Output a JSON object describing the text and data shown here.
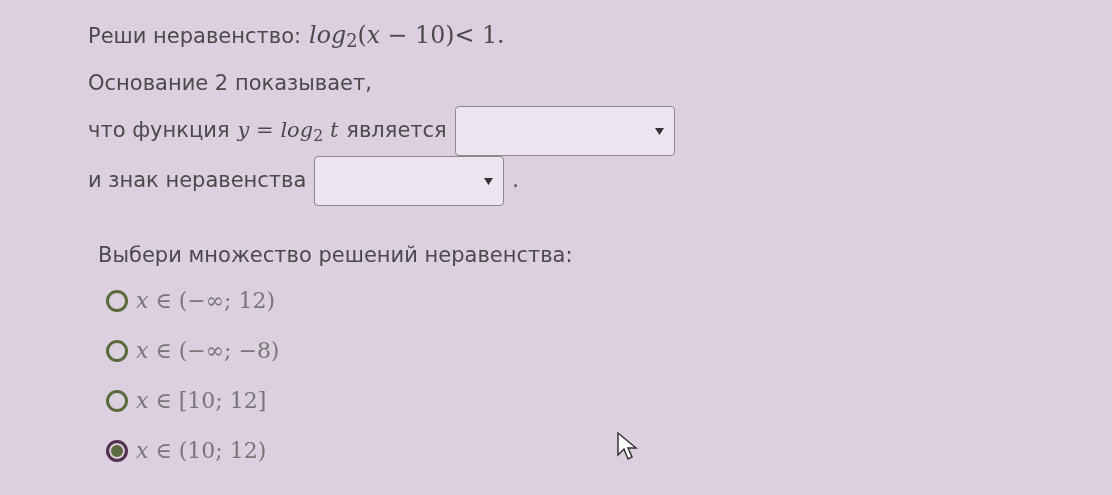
{
  "task": {
    "prompt": "Реши неравенство:",
    "expression": "*log*$_{2}$(*x* − 10)< 1."
  },
  "lines": [
    {
      "parts": [
        {
          "kind": "text",
          "text": "Основание 2 показывает,"
        }
      ]
    },
    {
      "parts": [
        {
          "kind": "text",
          "text": "что функция"
        },
        {
          "kind": "math",
          "text": "*y* = *log*$_{2}$ *t*"
        },
        {
          "kind": "text",
          "text": "является"
        },
        {
          "kind": "dropdown"
        }
      ]
    },
    {
      "parts": [
        {
          "kind": "text",
          "text": "и знак неравенства"
        },
        {
          "kind": "dropdown"
        },
        {
          "kind": "text",
          "text": "."
        }
      ]
    }
  ],
  "question": "Выбери множество решений неравенства:",
  "options": [
    {
      "label": "*x* ∈ (−∞; 12)",
      "selected": false
    },
    {
      "label": "*x* ∈ (−∞; −8)",
      "selected": false
    },
    {
      "label": "*x* ∈ [10; 12]",
      "selected": false
    },
    {
      "label": "*x* ∈ (10; 12)",
      "selected": true
    }
  ]
}
